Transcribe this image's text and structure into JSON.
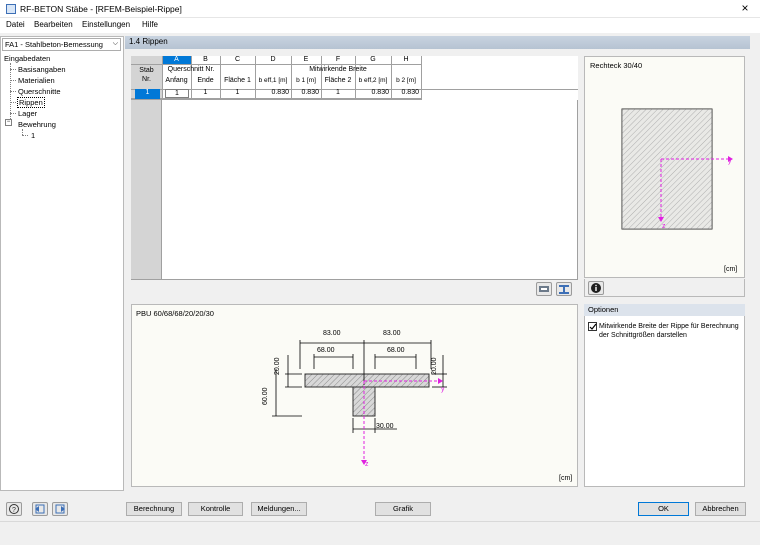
{
  "window": {
    "title": "RF-BETON Stäbe - [RFEM-Beispiel-Rippe]",
    "close": "×"
  },
  "menu": [
    "Datei",
    "Bearbeiten",
    "Einstellungen",
    "Hilfe"
  ],
  "case_select": "FA1 - Stahlbeton-Bemessung",
  "tree": {
    "root": "Eingabedaten",
    "items": [
      "Basisangaben",
      "Materialien",
      "Querschnitte",
      "Rippen",
      "Lager"
    ],
    "reinforcement": "Bewehrung",
    "reinforcement_child": "1",
    "selected": "Rippen"
  },
  "section_title": "1.4 Rippen",
  "table": {
    "col_letters": [
      "A",
      "B",
      "C",
      "D",
      "E",
      "F",
      "G",
      "H"
    ],
    "stab_header": [
      "Stab",
      "Nr."
    ],
    "group1": "Querschnitt Nr.",
    "group2": "Mitwirkende Breite",
    "col_headers": [
      "Anfang",
      "Ende",
      "Fläche 1",
      "b eff,1 [m]",
      "b 1 [m]",
      "Fläche 2",
      "b eff,2 [m]",
      "b 2 [m]"
    ],
    "rows": [
      {
        "stab": "1",
        "cells": [
          "1",
          "1",
          "1",
          "0.830",
          "0.830",
          "1",
          "0.830",
          "0.830"
        ]
      }
    ]
  },
  "cross_section": {
    "title": "Rechteck 30/40",
    "unit": "[cm]",
    "y": "y",
    "z": "z"
  },
  "graphic": {
    "title": "PBU 60/68/68/20/20/30",
    "unit": "[cm]",
    "dims": {
      "eff_left": "83.00",
      "eff_right": "83.00",
      "b_left": "68.00",
      "b_right": "68.00",
      "h_left": "20.00",
      "h_right": "20.00",
      "height": "60.00",
      "web": "30.00"
    },
    "y": "y",
    "z": "z"
  },
  "options": {
    "title": "Optionen",
    "checkbox_label": "Mitwirkende Breite der Rippe für Berechnung der Schnittgrößen darstellen",
    "checked": true
  },
  "buttons": {
    "berechnung": "Berechnung",
    "kontrolle": "Kontrolle",
    "meldungen": "Meldungen...",
    "grafik": "Grafik",
    "ok": "OK",
    "abbrechen": "Abbrechen"
  },
  "colors": {
    "accent": "#0078d7",
    "axis": "#e020e0",
    "hatch": "#808080"
  }
}
